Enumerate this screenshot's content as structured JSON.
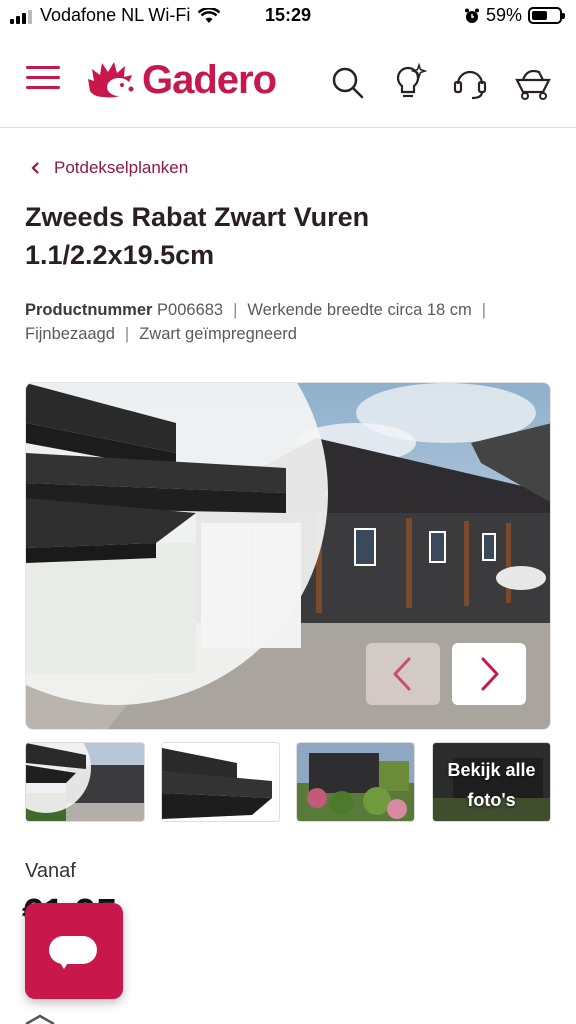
{
  "status_bar": {
    "carrier": "Vodafone NL Wi-Fi",
    "time": "15:29",
    "battery": "59%",
    "battery_level": 0.59
  },
  "header": {
    "brand": "Gadero",
    "brand_color": "#c8174b",
    "icons": [
      "menu-icon",
      "search-icon",
      "ideas-icon",
      "customer-service-icon",
      "cart-icon"
    ]
  },
  "breadcrumb": {
    "label": "Potdekselplanken"
  },
  "product": {
    "title_line1": "Zweeds Rabat Zwart Vuren",
    "title_line2": "1.1/2.2x19.5cm",
    "product_number_label": "Productnummer",
    "product_number": "P006683",
    "spec1": "Werkende breedte circa 18 cm",
    "spec2": "Fijnbezaagd",
    "spec3": "Zwart geïmpregneerd",
    "separator": "|"
  },
  "gallery": {
    "prev_icon": "chevron-left-icon",
    "next_icon": "chevron-right-icon",
    "thumbnails_last_label_line1": "Bekijk alle",
    "thumbnails_last_label_line2": "foto's"
  },
  "pricing": {
    "from_label": "Vanaf",
    "price": "€1,95"
  },
  "chat": {
    "icon": "chat-bubble-icon"
  }
}
